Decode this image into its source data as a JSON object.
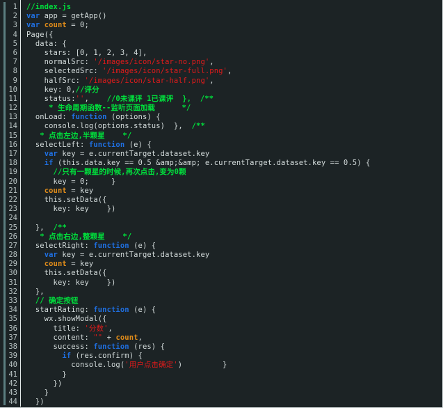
{
  "editor": {
    "title": "index.js",
    "language": "javascript",
    "total_lines": 44,
    "theme": {
      "background": "#1c2325",
      "foreground": "#d4dcdc",
      "gutter_text": "#b9c4c4",
      "gutter_border": "#e3e9e9",
      "accent_bar": "#5b7e80",
      "comment": "#00e03c",
      "keyword": "#1f6fe0",
      "string": "#e01b1b",
      "variable": "#e08c1a",
      "page_border": "#cfd6d6"
    }
  },
  "lines": [
    {
      "n": "1",
      "tokens": [
        {
          "t": "comment",
          "s": "//index.js"
        }
      ]
    },
    {
      "n": "2",
      "tokens": [
        {
          "t": "keyword",
          "s": "var"
        },
        {
          "t": "plain",
          "s": " app = getApp()"
        }
      ]
    },
    {
      "n": "3",
      "tokens": [
        {
          "t": "keyword",
          "s": "var"
        },
        {
          "t": "plain",
          "s": " "
        },
        {
          "t": "var",
          "s": "count"
        },
        {
          "t": "plain",
          "s": " = 0;"
        }
      ]
    },
    {
      "n": "4",
      "tokens": [
        {
          "t": "plain",
          "s": "Page({"
        }
      ]
    },
    {
      "n": "5",
      "tokens": [
        {
          "t": "plain",
          "s": "  data: {"
        }
      ]
    },
    {
      "n": "6",
      "tokens": [
        {
          "t": "plain",
          "s": "    stars: [0, 1, 2, 3, 4],"
        }
      ]
    },
    {
      "n": "7",
      "tokens": [
        {
          "t": "plain",
          "s": "    normalSrc: "
        },
        {
          "t": "string",
          "s": "'/images/icon/star-no.png'"
        },
        {
          "t": "plain",
          "s": ","
        }
      ]
    },
    {
      "n": "8",
      "tokens": [
        {
          "t": "plain",
          "s": "    selectedSrc: "
        },
        {
          "t": "string",
          "s": "'/images/icon/star-full.png'"
        },
        {
          "t": "plain",
          "s": ","
        }
      ]
    },
    {
      "n": "9",
      "tokens": [
        {
          "t": "plain",
          "s": "    halfSrc: "
        },
        {
          "t": "string",
          "s": "'/images/icon/star-half.png'"
        },
        {
          "t": "plain",
          "s": ","
        }
      ]
    },
    {
      "n": "10",
      "tokens": [
        {
          "t": "plain",
          "s": "    key: 0,"
        },
        {
          "t": "comment",
          "s": "//评分"
        }
      ]
    },
    {
      "n": "11",
      "tokens": [
        {
          "t": "plain",
          "s": "    status:"
        },
        {
          "t": "string",
          "s": "''"
        },
        {
          "t": "plain",
          "s": ",    "
        },
        {
          "t": "comment",
          "s": "//0未课评 1已课评  },  /**"
        }
      ]
    },
    {
      "n": "12",
      "tokens": [
        {
          "t": "comment",
          "s": "     * 生命周期函数--监听页面加载      */"
        }
      ]
    },
    {
      "n": "13",
      "tokens": [
        {
          "t": "plain",
          "s": "  onLoad: "
        },
        {
          "t": "keyword",
          "s": "function"
        },
        {
          "t": "plain",
          "s": " (options) {"
        }
      ]
    },
    {
      "n": "14",
      "tokens": [
        {
          "t": "plain",
          "s": "    console.log(options.status)  },  "
        },
        {
          "t": "comment",
          "s": "/**"
        }
      ]
    },
    {
      "n": "15",
      "tokens": [
        {
          "t": "comment",
          "s": "   * 点击左边,半颗星    */"
        }
      ]
    },
    {
      "n": "16",
      "tokens": [
        {
          "t": "plain",
          "s": "  selectLeft: "
        },
        {
          "t": "keyword",
          "s": "function"
        },
        {
          "t": "plain",
          "s": " (e) {"
        }
      ]
    },
    {
      "n": "17",
      "tokens": [
        {
          "t": "plain",
          "s": "    "
        },
        {
          "t": "keyword",
          "s": "var"
        },
        {
          "t": "plain",
          "s": " key = e.currentTarget.dataset.key"
        }
      ]
    },
    {
      "n": "18",
      "tokens": [
        {
          "t": "plain",
          "s": "    "
        },
        {
          "t": "keyword",
          "s": "if"
        },
        {
          "t": "plain",
          "s": " (this.data.key == 0.5 &amp;&amp; e.currentTarget.dataset.key == 0.5) {"
        }
      ]
    },
    {
      "n": "19",
      "tokens": [
        {
          "t": "plain",
          "s": "      "
        },
        {
          "t": "comment",
          "s": "//只有一颗星的时候,再次点击,变为0颗"
        }
      ]
    },
    {
      "n": "20",
      "tokens": [
        {
          "t": "plain",
          "s": "      key = 0;     }"
        }
      ]
    },
    {
      "n": "21",
      "tokens": [
        {
          "t": "plain",
          "s": "    "
        },
        {
          "t": "var",
          "s": "count"
        },
        {
          "t": "plain",
          "s": " = key"
        }
      ]
    },
    {
      "n": "22",
      "tokens": [
        {
          "t": "plain",
          "s": "    this.setData({"
        }
      ]
    },
    {
      "n": "23",
      "tokens": [
        {
          "t": "plain",
          "s": "      key: key    })"
        }
      ]
    },
    {
      "n": "24",
      "tokens": [
        {
          "t": "plain",
          "s": ""
        }
      ]
    },
    {
      "n": "25",
      "tokens": [
        {
          "t": "plain",
          "s": "  },  "
        },
        {
          "t": "comment",
          "s": "/**"
        }
      ]
    },
    {
      "n": "26",
      "tokens": [
        {
          "t": "comment",
          "s": "   * 点击右边,整颗星    */"
        }
      ]
    },
    {
      "n": "27",
      "tokens": [
        {
          "t": "plain",
          "s": "  selectRight: "
        },
        {
          "t": "keyword",
          "s": "function"
        },
        {
          "t": "plain",
          "s": " (e) {"
        }
      ]
    },
    {
      "n": "28",
      "tokens": [
        {
          "t": "plain",
          "s": "    "
        },
        {
          "t": "keyword",
          "s": "var"
        },
        {
          "t": "plain",
          "s": " key = e.currentTarget.dataset.key"
        }
      ]
    },
    {
      "n": "29",
      "tokens": [
        {
          "t": "plain",
          "s": "    "
        },
        {
          "t": "var",
          "s": "count"
        },
        {
          "t": "plain",
          "s": " = key"
        }
      ]
    },
    {
      "n": "30",
      "tokens": [
        {
          "t": "plain",
          "s": "    this.setData({"
        }
      ]
    },
    {
      "n": "31",
      "tokens": [
        {
          "t": "plain",
          "s": "      key: key    })"
        }
      ]
    },
    {
      "n": "32",
      "tokens": [
        {
          "t": "plain",
          "s": "  },"
        }
      ]
    },
    {
      "n": "33",
      "tokens": [
        {
          "t": "plain",
          "s": "  "
        },
        {
          "t": "comment",
          "s": "// 确定按钮"
        }
      ]
    },
    {
      "n": "34",
      "tokens": [
        {
          "t": "plain",
          "s": "  startRating: "
        },
        {
          "t": "keyword",
          "s": "function"
        },
        {
          "t": "plain",
          "s": " (e) {"
        }
      ]
    },
    {
      "n": "35",
      "tokens": [
        {
          "t": "plain",
          "s": "    wx.showModal({"
        }
      ]
    },
    {
      "n": "36",
      "tokens": [
        {
          "t": "plain",
          "s": "      title: "
        },
        {
          "t": "string",
          "s": "'分数'"
        },
        {
          "t": "plain",
          "s": ","
        }
      ]
    },
    {
      "n": "37",
      "tokens": [
        {
          "t": "plain",
          "s": "      content: "
        },
        {
          "t": "string",
          "s": "\"\""
        },
        {
          "t": "plain",
          "s": " + "
        },
        {
          "t": "var",
          "s": "count"
        },
        {
          "t": "plain",
          "s": ","
        }
      ]
    },
    {
      "n": "38",
      "tokens": [
        {
          "t": "plain",
          "s": "      success: "
        },
        {
          "t": "keyword",
          "s": "function"
        },
        {
          "t": "plain",
          "s": " (res) {"
        }
      ]
    },
    {
      "n": "39",
      "tokens": [
        {
          "t": "plain",
          "s": "        "
        },
        {
          "t": "keyword",
          "s": "if"
        },
        {
          "t": "plain",
          "s": " (res.confirm) {"
        }
      ]
    },
    {
      "n": "40",
      "tokens": [
        {
          "t": "plain",
          "s": "          console.log("
        },
        {
          "t": "string",
          "s": "'用户点击确定'"
        },
        {
          "t": "plain",
          "s": ")         }"
        }
      ]
    },
    {
      "n": "41",
      "tokens": [
        {
          "t": "plain",
          "s": "        }"
        }
      ]
    },
    {
      "n": "42",
      "tokens": [
        {
          "t": "plain",
          "s": "      })"
        }
      ]
    },
    {
      "n": "43",
      "tokens": [
        {
          "t": "plain",
          "s": "    }"
        }
      ]
    },
    {
      "n": "44",
      "tokens": [
        {
          "t": "plain",
          "s": "  })"
        }
      ]
    }
  ]
}
